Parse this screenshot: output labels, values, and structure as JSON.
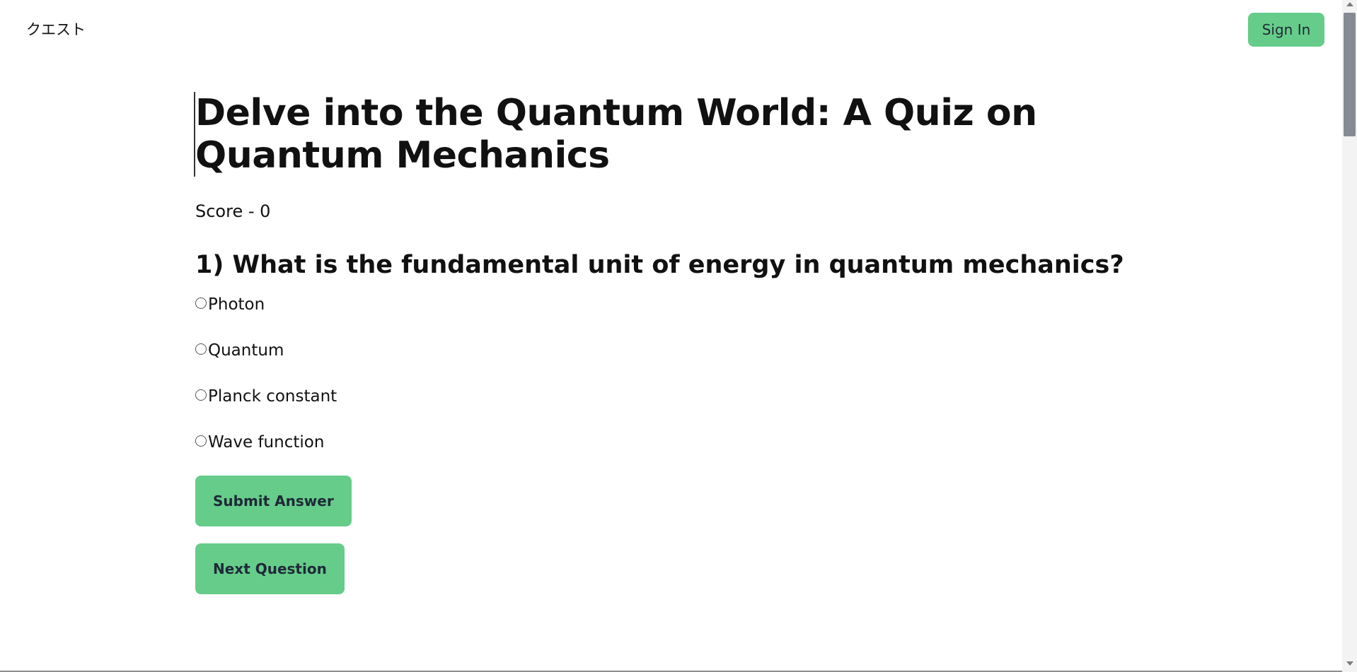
{
  "header": {
    "logo": "クエスト",
    "signin_label": "Sign In"
  },
  "quiz": {
    "title": "Delve into the Quantum World: A Quiz on Quantum Mechanics",
    "score_text": "Score - 0",
    "question_text": "1) What is the fundamental unit of energy in quantum mechanics?",
    "options": [
      {
        "label": "Photon",
        "selected": false
      },
      {
        "label": "Quantum",
        "selected": false
      },
      {
        "label": "Planck constant",
        "selected": false
      },
      {
        "label": "Wave function",
        "selected": false
      }
    ],
    "submit_label": "Submit Answer",
    "next_label": "Next Question"
  },
  "colors": {
    "accent": "#66cc8a",
    "button_text": "#1f2937",
    "text": "#111111"
  }
}
